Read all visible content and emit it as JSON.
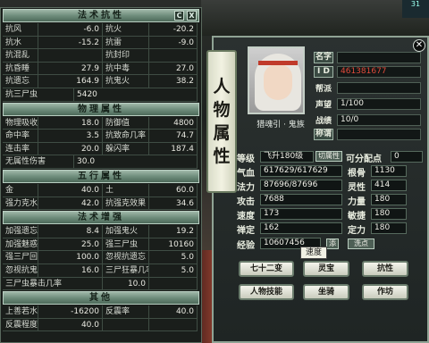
{
  "left": {
    "resist_title": "法术抗性",
    "resist": [
      [
        "抗风",
        "-6.0",
        "抗火",
        "-20.2"
      ],
      [
        "抗水",
        "-15.2",
        "抗雷",
        "-9.0"
      ],
      [
        "抗混乱",
        "",
        "抗封印",
        ""
      ],
      [
        "抗昏睡",
        "27.9",
        "抗中毒",
        "27.0"
      ],
      [
        "抗遗忘",
        "164.9",
        "抗鬼火",
        "38.2"
      ]
    ],
    "resist_extra": [
      "抗三尸虫",
      "5420"
    ],
    "physical_title": "物理属性",
    "physical": [
      [
        "物理吸收率",
        "18.0",
        "防御值",
        "4800"
      ],
      [
        "命中率",
        "3.5",
        "抗致命几率",
        "74.7"
      ],
      [
        "连击率",
        "20.0",
        "躲闪率",
        "187.4"
      ]
    ],
    "physical_extra": [
      "无属性伤害",
      "30.0"
    ],
    "five_title": "五行属性",
    "five": [
      [
        "金",
        "40.0",
        "土",
        "60.0"
      ],
      [
        "强力克水",
        "42.0",
        "抗强克效果",
        "34.6"
      ]
    ],
    "boost_title": "法术增强",
    "boost": [
      [
        "加强遗忘",
        "8.4",
        "加强鬼火",
        "19.2"
      ],
      [
        "加强魅惑",
        "25.0",
        "强三尸虫",
        "10160"
      ],
      [
        "强三尸回血",
        "100.0",
        "忽视抗遗忘",
        "5.0"
      ],
      [
        "忽视抗鬼火",
        "16.0",
        "三尸狂暴几率",
        "5.0"
      ],
      [
        "三尸虫暴击几率",
        "10.0",
        "",
        ""
      ]
    ],
    "other_title": "其他",
    "other": [
      [
        "上善若水",
        "-16200",
        "反震率",
        "40.0"
      ],
      [
        "反震程度",
        "40.0",
        "",
        ""
      ]
    ],
    "header_buttons": [
      "C",
      "X"
    ]
  },
  "right": {
    "banner": [
      "人",
      "物",
      "属",
      "性"
    ],
    "close_icon": "✕",
    "portrait_name": "猎魂引 · 鬼族",
    "fields": {
      "name_label": "名字",
      "id_label": "I D",
      "id_value": "461381677",
      "gang_label": "帮派",
      "fame_label": "声望",
      "fame_value": "1/100",
      "battle_label": "战绩",
      "battle_value": "10/0",
      "title_label": "称谓"
    },
    "stats": {
      "grade_label": "等级",
      "grade_value": "飞升180级",
      "switch_attr": "切属性",
      "free_points_label": "可分配点",
      "free_points_value": "0",
      "hp_label": "气血",
      "hp_value": "617629/617629",
      "mp_label": "法力",
      "mp_value": "87696/87696",
      "atk_label": "攻击",
      "atk_value": "7688",
      "spd_label": "速度",
      "spd_value": "173",
      "dao_label": "禅定",
      "dao_value": "162",
      "exp_label": "经验",
      "exp_value": "10607456",
      "add_btn": "添",
      "wash_btn": "洗点",
      "gengu_label": "根骨",
      "gengu_value": "1130",
      "lingxing_label": "灵性",
      "lingxing_value": "414",
      "liliang_label": "力量",
      "liliang_value": "180",
      "minjie_label": "敏捷",
      "minjie_value": "180",
      "dingli_label": "定力",
      "dingli_value": "180"
    },
    "tooltip": "速度",
    "buttons": [
      "七十二变",
      "灵宝",
      "抗性",
      "人物技能",
      "坐骑",
      "作坊"
    ]
  },
  "colors": {
    "accent": "#6f8d7c",
    "red_value": "#e04a3a"
  },
  "top_right_badge": "31"
}
